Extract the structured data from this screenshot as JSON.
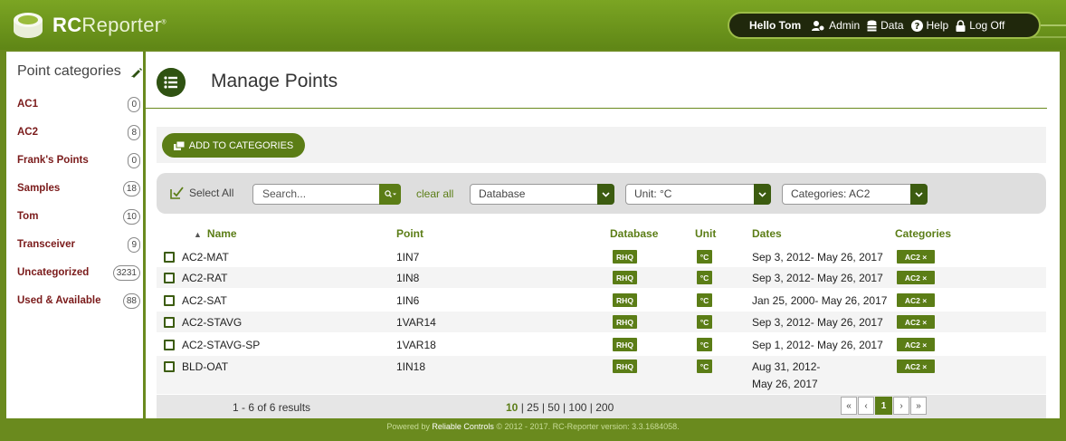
{
  "header": {
    "brand_bold": "RC",
    "brand_thin": "Reporter",
    "brand_mark": "®",
    "greeting": "Hello Tom",
    "nav": [
      {
        "label": "Admin",
        "icon": "admin-icon"
      },
      {
        "label": "Data",
        "icon": "database-icon"
      },
      {
        "label": "Help",
        "icon": "help-icon"
      },
      {
        "label": "Log Off",
        "icon": "lock-icon"
      }
    ]
  },
  "sidebar": {
    "title": "Point categories",
    "items": [
      {
        "label": "AC1",
        "count": "0"
      },
      {
        "label": "AC2",
        "count": "8"
      },
      {
        "label": "Frank's Points",
        "count": "0"
      },
      {
        "label": "Samples",
        "count": "18"
      },
      {
        "label": "Tom",
        "count": "10"
      },
      {
        "label": "Transceiver",
        "count": "9"
      },
      {
        "label": "Uncategorized",
        "count": "3231"
      },
      {
        "label": "Used & Available",
        "count": "88"
      }
    ]
  },
  "main": {
    "title": "Manage Points",
    "add_button": "ADD TO CATEGORIES",
    "select_all": "Select All",
    "search_placeholder": "Search...",
    "clear_all": "clear all",
    "database_filter": "Database",
    "unit_filter": "Unit: °C",
    "categories_filter": "Categories: AC2"
  },
  "table": {
    "headers": {
      "sort_arrow": "▲",
      "name": "Name",
      "point": "Point",
      "database": "Database",
      "unit": "Unit",
      "dates": "Dates",
      "categories": "Categories"
    },
    "rows": [
      {
        "name": "AC2-MAT",
        "point": "1IN7",
        "database": "RHQ",
        "unit": "°C",
        "dates": "Sep 3, 2012- May 26, 2017",
        "dates2": "",
        "category": "AC2 ×"
      },
      {
        "name": "AC2-RAT",
        "point": "1IN8",
        "database": "RHQ",
        "unit": "°C",
        "dates": "Sep 3, 2012- May 26, 2017",
        "dates2": "",
        "category": "AC2 ×"
      },
      {
        "name": "AC2-SAT",
        "point": "1IN6",
        "database": "RHQ",
        "unit": "°C",
        "dates": "Jan 25, 2000- May 26, 2017",
        "dates2": "",
        "category": "AC2 ×"
      },
      {
        "name": "AC2-STAVG",
        "point": "1VAR14",
        "database": "RHQ",
        "unit": "°C",
        "dates": "Sep 3, 2012- May 26, 2017",
        "dates2": "",
        "category": "AC2 ×"
      },
      {
        "name": "AC2-STAVG-SP",
        "point": "1VAR18",
        "database": "RHQ",
        "unit": "°C",
        "dates": "Sep 1, 2012- May 26, 2017",
        "dates2": "",
        "category": "AC2 ×"
      },
      {
        "name": "BLD-OAT",
        "point": "1IN18",
        "database": "RHQ",
        "unit": "°C",
        "dates": "Aug 31, 2012-",
        "dates2": "May 26, 2017",
        "category": "AC2 ×"
      }
    ]
  },
  "pagination": {
    "results": "1 - 6 of 6 results",
    "size_active": "10",
    "sizes_rest": " | 25 | 50 | 100 | 200",
    "first": "«",
    "prev": "‹",
    "current": "1",
    "next": "›",
    "last": "»"
  },
  "footer": {
    "prefix": "Powered by ",
    "company": "Reliable Controls",
    "suffix": " © 2012 - 2017. RC-Reporter version: 3.3.1684058."
  },
  "colors": {
    "brand_green": "#5b7d16",
    "header_green": "#6a8a1e",
    "category_red": "#7a1a1a"
  }
}
